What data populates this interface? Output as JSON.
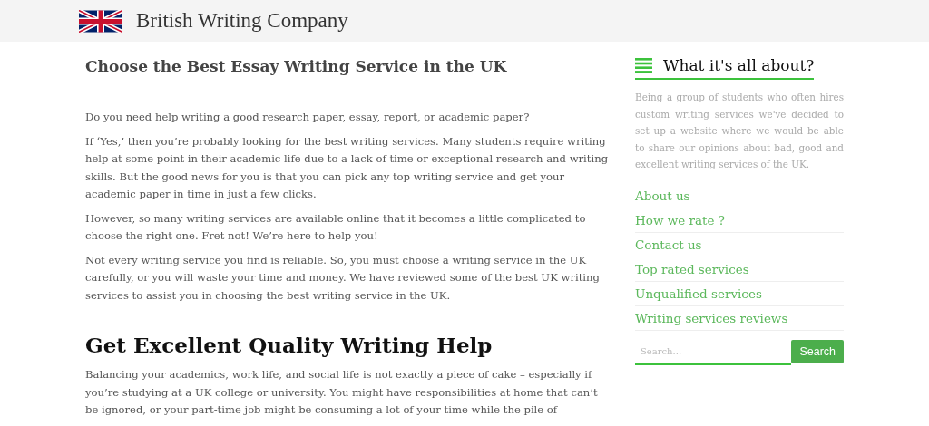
{
  "header": {
    "site_title": "British Writing Company"
  },
  "article": {
    "title": "Choose the Best Essay Writing Service in the UK",
    "paragraphs": [
      "Do you need help writing a good research paper, essay, report, or academic paper?",
      "If ‘Yes,’ then you’re probably looking for the best writing services. Many students require writing help at some point in their academic life due to a lack of time or exceptional research and writing skills. But the good news for you is that you can pick any top writing service and get your academic paper in time in just a few clicks.",
      "However, so many writing services are available online that it becomes a little complicated to choose the right one. Fret not! We’re here to help you!",
      "Not every writing service you find is reliable. So, you must choose a writing service in the UK carefully, or you will waste your time and money. We have reviewed some of the best UK writing services to assist you in choosing the best writing service in the UK."
    ],
    "subheading": "Get Excellent Quality Writing Help",
    "paragraphs_2": [
      "Balancing your academics, work life, and social life is not exactly a piece of cake – especially if you’re studying at a UK college or university. You might have responsibilities at home that can’t be ignored, or your part-time job might be consuming a lot of your time while the pile of"
    ]
  },
  "sidebar": {
    "title": "What it's all about?",
    "intro": "Being a group of students who often hires custom writing services we've decided to set up a website where we would be able to share our opinions about bad, good and excellent writing services of the UK.",
    "links": [
      "About us",
      "How we rate ?",
      "Contact us",
      "Top rated services",
      "Unqualified services",
      "Writing services reviews"
    ],
    "search": {
      "placeholder": "Search...",
      "button": "Search"
    }
  }
}
